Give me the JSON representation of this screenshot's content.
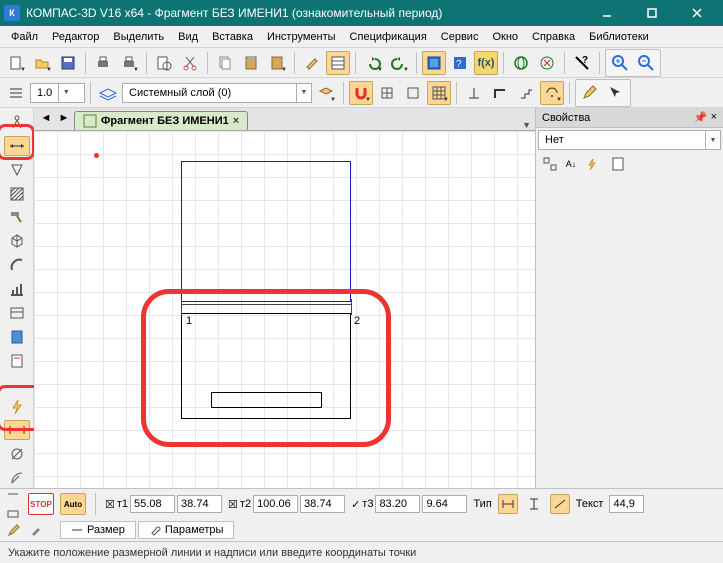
{
  "title": "КОМПАС-3D V16  x64 - Фрагмент БЕЗ ИМЕНИ1 (ознакомительный период)",
  "menu": [
    "Файл",
    "Редактор",
    "Выделить",
    "Вид",
    "Вставка",
    "Инструменты",
    "Спецификация",
    "Сервис",
    "Окно",
    "Справка",
    "Библиотеки"
  ],
  "line_width_combo": "1.0",
  "layer_combo": "Системный слой (0)",
  "tab_name": "Фрагмент БЕЗ ИМЕНИ1",
  "right_panel": {
    "title": "Свойства",
    "filter": "Нет"
  },
  "dim_points": {
    "p1": "1",
    "p2": "2"
  },
  "inputs": {
    "t1_label": "т1",
    "t1_x": "55.08",
    "t1_y": "38.74",
    "t2_label": "т2",
    "t2_x": "100.06",
    "t2_y": "38.74",
    "t3_label": "т3",
    "t3_x": "83.20",
    "t3_y": "9.64",
    "type_label": "Тип",
    "text_label": "Текст",
    "text_val": "44,9"
  },
  "bottom_tabs": {
    "size": "Размер",
    "params": "Параметры"
  },
  "status": "Укажите положение размерной линии и надписи или введите координаты точки"
}
